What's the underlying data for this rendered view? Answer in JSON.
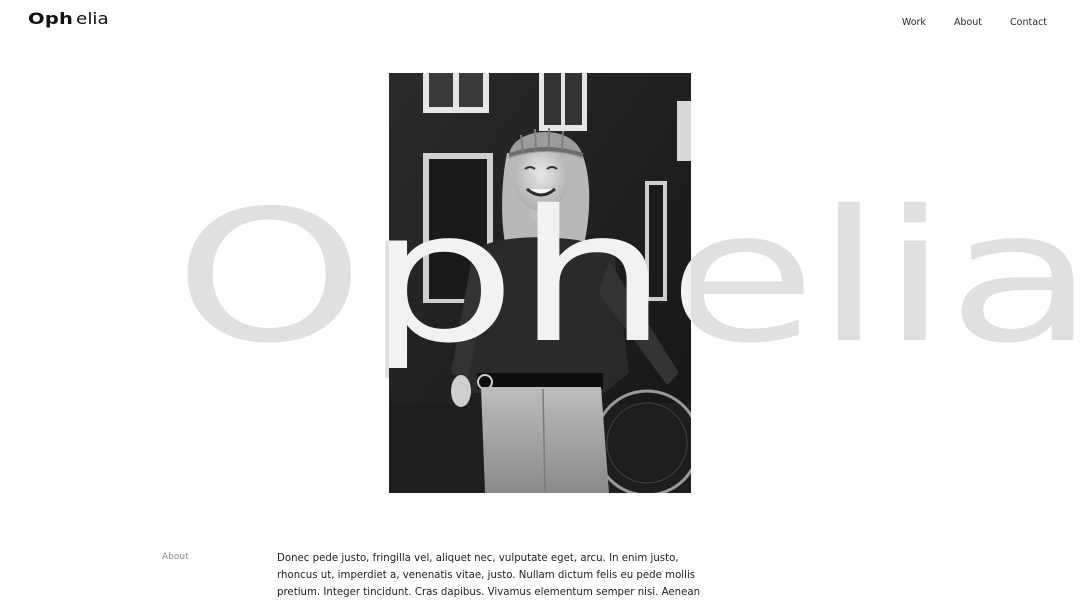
{
  "header": {
    "logo_bold": "Oph",
    "logo_light": "elia",
    "nav": [
      {
        "label": "Work"
      },
      {
        "label": "About"
      },
      {
        "label": "Contact"
      }
    ]
  },
  "hero": {
    "display_word": "Ophelia",
    "photo_description_icon": "portrait-photo"
  },
  "about": {
    "label": "About",
    "body": "Donec pede justo, fringilla vel, aliquet nec, vulputate eget, arcu. In enim justo, rhoncus ut, imperdiet a, venenatis vitae, justo. Nullam dictum felis eu pede mollis pretium. Integer tincidunt. Cras dapibus. Vivamus elementum semper nisi. Aenean vulputate eleifend tellus."
  },
  "colors": {
    "background": "#ffffff",
    "hero_text": "#e0e0e0",
    "text": "#1e1e1e",
    "muted": "#8a8a8a"
  }
}
